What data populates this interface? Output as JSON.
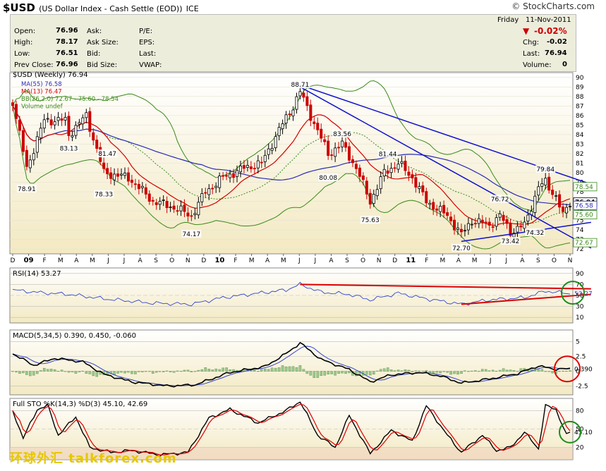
{
  "header": {
    "symbol": "$USD",
    "name": "(US Dollar Index - Cash Settle (EOD))",
    "exchange": "ICE",
    "brand": "© StockCharts.com",
    "day": "Friday",
    "date": "11-Nov-2011"
  },
  "quote": {
    "open_label": "Open:",
    "open": "76.96",
    "high_label": "High:",
    "high": "78.17",
    "low_label": "Low:",
    "low": "76.51",
    "prev_label": "Prev Close:",
    "prev": "76.96",
    "ask_label": "Ask:",
    "asksize_label": "Ask Size:",
    "bid_label": "Bid:",
    "bidsize_label": "Bid Size:",
    "pe_label": "P/E:",
    "eps_label": "EPS:",
    "last_label": "Last:",
    "vwap_label": "VWAP:",
    "pct_change": "-0.02%",
    "chg_label": "Chg:",
    "chg": "-0.02",
    "last2_label": "Last:",
    "last": "76.94",
    "vol_label": "Volume:",
    "volume": "0"
  },
  "watermark": "环球外汇 talkforex.com",
  "colors": {
    "price_bg_top": "#ffffff",
    "price_bg_bottom": "#f3e9c2",
    "up": "#000000",
    "down": "#cc0000",
    "ma55": "#2b2bb3",
    "ma13": "#d40000",
    "bb": "#3a8a1a",
    "trend": "#1010cc",
    "rsi_trend": "#dd0000"
  },
  "chart_data": [
    {
      "type": "candlestick",
      "title": "$USD (Weekly) 76.94",
      "legend": [
        "MA(55) 76.58",
        "MA(13) 76.47",
        "BB(26,2.0) 72.67 - 75.60 - 78.54",
        "Volume undef"
      ],
      "x_ticks": [
        "D",
        "09",
        "F",
        "M",
        "A",
        "M",
        "J",
        "J",
        "A",
        "S",
        "O",
        "N",
        "D",
        "10",
        "F",
        "M",
        "A",
        "M",
        "J",
        "J",
        "A",
        "S",
        "O",
        "N",
        "D",
        "11",
        "F",
        "M",
        "A",
        "M",
        "J",
        "J",
        "A",
        "S",
        "O",
        "N"
      ],
      "ylim": [
        71.5,
        90.5
      ],
      "y_ticks": [
        72,
        73,
        74,
        75,
        76,
        77,
        78,
        79,
        80,
        81,
        82,
        83,
        84,
        85,
        86,
        87,
        88,
        89,
        90
      ],
      "right_tags": [
        "78.54",
        "76.94",
        "76.58",
        "75.60",
        "72.67"
      ],
      "annotations": [
        {
          "label": "78.91",
          "x": 4,
          "y": 78.91,
          "pos": "below"
        },
        {
          "label": "83.13",
          "x": 16,
          "y": 83.13,
          "pos": "below"
        },
        {
          "label": "81.47",
          "x": 27,
          "y": 81.47,
          "pos": "above"
        },
        {
          "label": "78.33",
          "x": 26,
          "y": 78.33,
          "pos": "below"
        },
        {
          "label": "74.17",
          "x": 51,
          "y": 74.17,
          "pos": "below"
        },
        {
          "label": "88.71",
          "x": 82,
          "y": 88.71,
          "pos": "above"
        },
        {
          "label": "83.56",
          "x": 94,
          "y": 83.56,
          "pos": "above"
        },
        {
          "label": "80.08",
          "x": 90,
          "y": 80.08,
          "pos": "below"
        },
        {
          "label": "81.44",
          "x": 107,
          "y": 81.44,
          "pos": "above"
        },
        {
          "label": "75.63",
          "x": 102,
          "y": 75.63,
          "pos": "below"
        },
        {
          "label": "72.70",
          "x": 128,
          "y": 72.7,
          "pos": "below"
        },
        {
          "label": "73.42",
          "x": 142,
          "y": 73.42,
          "pos": "below"
        },
        {
          "label": "76.72",
          "x": 139,
          "y": 76.72,
          "pos": "above"
        },
        {
          "label": "79.84",
          "x": 152,
          "y": 79.84,
          "pos": "above"
        },
        {
          "label": "74.32",
          "x": 149,
          "y": 74.32,
          "pos": "below"
        }
      ],
      "trendlines": [
        [
          82,
          89.2,
          165,
          78.8
        ],
        [
          82,
          89.0,
          165,
          72.1
        ],
        [
          128,
          72.8,
          165,
          74.8
        ]
      ],
      "key_points": [
        [
          0,
          87.5
        ],
        [
          4,
          80.5
        ],
        [
          9,
          85.5
        ],
        [
          15,
          85.5
        ],
        [
          16,
          84.0
        ],
        [
          21,
          86.0
        ],
        [
          26,
          80.0
        ],
        [
          33,
          79.5
        ],
        [
          40,
          77.0
        ],
        [
          45,
          76.5
        ],
        [
          51,
          75.5
        ],
        [
          55,
          78.0
        ],
        [
          60,
          79.5
        ],
        [
          66,
          80.5
        ],
        [
          71,
          81.0
        ],
        [
          76,
          84.5
        ],
        [
          80,
          87.0
        ],
        [
          82,
          88.5
        ],
        [
          85,
          86.0
        ],
        [
          90,
          82.0
        ],
        [
          94,
          83.0
        ],
        [
          98,
          80.5
        ],
        [
          102,
          77.0
        ],
        [
          106,
          80.0
        ],
        [
          110,
          81.0
        ],
        [
          114,
          79.5
        ],
        [
          118,
          77.0
        ],
        [
          124,
          75.5
        ],
        [
          128,
          73.5
        ],
        [
          131,
          75.0
        ],
        [
          136,
          74.5
        ],
        [
          139,
          75.5
        ],
        [
          142,
          73.8
        ],
        [
          146,
          74.5
        ],
        [
          150,
          78.5
        ],
        [
          152,
          79.0
        ],
        [
          155,
          77.5
        ],
        [
          157,
          75.5
        ],
        [
          159,
          76.94
        ]
      ]
    },
    {
      "type": "line",
      "title": "RSI(14) 53.27",
      "ylim": [
        0,
        100
      ],
      "y_ticks": [
        10,
        30,
        50,
        70,
        90
      ],
      "values_key": [
        [
          0,
          60
        ],
        [
          8,
          55
        ],
        [
          16,
          52
        ],
        [
          26,
          44
        ],
        [
          40,
          36
        ],
        [
          51,
          34
        ],
        [
          60,
          46
        ],
        [
          70,
          54
        ],
        [
          78,
          60
        ],
        [
          82,
          70
        ],
        [
          88,
          56
        ],
        [
          96,
          52
        ],
        [
          102,
          42
        ],
        [
          110,
          54
        ],
        [
          118,
          44
        ],
        [
          128,
          34
        ],
        [
          136,
          42
        ],
        [
          146,
          46
        ],
        [
          152,
          58
        ],
        [
          159,
          53.27
        ]
      ],
      "tag": "53.27",
      "trendlines": [
        [
          82,
          70,
          165,
          62
        ],
        [
          128,
          34,
          165,
          52
        ]
      ]
    },
    {
      "type": "line",
      "title": "MACD(5,34,5) 0.390, 0.450, -0.060",
      "ylim": [
        -4,
        7
      ],
      "y_ticks": [
        -2.5,
        0.0,
        2.5,
        5.0
      ],
      "macd_key": [
        [
          0,
          3.0
        ],
        [
          6,
          1.0
        ],
        [
          12,
          2.2
        ],
        [
          20,
          1.6
        ],
        [
          26,
          -0.5
        ],
        [
          34,
          -1.8
        ],
        [
          44,
          -2.5
        ],
        [
          52,
          -2.3
        ],
        [
          62,
          -0.2
        ],
        [
          72,
          0.8
        ],
        [
          78,
          3.0
        ],
        [
          82,
          4.8
        ],
        [
          88,
          2.0
        ],
        [
          96,
          0.3
        ],
        [
          102,
          -1.8
        ],
        [
          108,
          -0.6
        ],
        [
          116,
          -0.2
        ],
        [
          122,
          -0.8
        ],
        [
          128,
          -2.0
        ],
        [
          136,
          -1.3
        ],
        [
          144,
          -0.4
        ],
        [
          150,
          0.9
        ],
        [
          154,
          0.4
        ],
        [
          159,
          0.39
        ]
      ],
      "tag": "0.390"
    },
    {
      "type": "line",
      "title": "Full STO %K(14,3) %D(3) 45.10, 42.69",
      "ylim": [
        0,
        100
      ],
      "y_ticks": [
        20,
        50,
        80
      ],
      "k_key": [
        [
          0,
          80
        ],
        [
          3,
          35
        ],
        [
          7,
          82
        ],
        [
          10,
          88
        ],
        [
          13,
          40
        ],
        [
          18,
          70
        ],
        [
          22,
          20
        ],
        [
          28,
          12
        ],
        [
          34,
          15
        ],
        [
          42,
          8
        ],
        [
          50,
          12
        ],
        [
          56,
          68
        ],
        [
          62,
          82
        ],
        [
          70,
          60
        ],
        [
          78,
          80
        ],
        [
          82,
          95
        ],
        [
          87,
          40
        ],
        [
          92,
          20
        ],
        [
          96,
          72
        ],
        [
          102,
          10
        ],
        [
          108,
          48
        ],
        [
          114,
          30
        ],
        [
          118,
          88
        ],
        [
          124,
          40
        ],
        [
          128,
          12
        ],
        [
          134,
          40
        ],
        [
          138,
          15
        ],
        [
          142,
          20
        ],
        [
          146,
          45
        ],
        [
          150,
          18
        ],
        [
          152,
          88
        ],
        [
          155,
          82
        ],
        [
          158,
          40
        ],
        [
          159,
          45.1
        ]
      ],
      "tag": "45.10"
    }
  ]
}
